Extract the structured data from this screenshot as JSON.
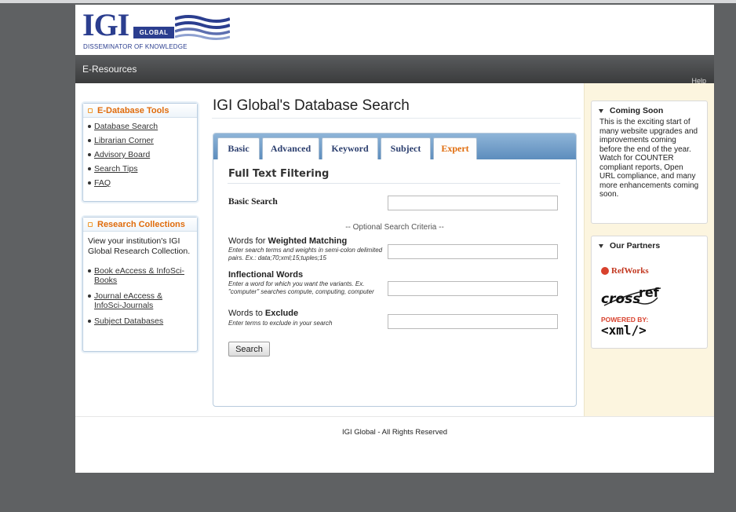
{
  "header": {
    "logo_main": "IGI",
    "logo_box": "GLOBAL",
    "logo_tagline": "DISSEMINATOR OF KNOWLEDGE",
    "nav_title": "E-Resources",
    "nav_right": "Help"
  },
  "sidebar": {
    "tools": {
      "title": "E-Database Tools",
      "items": [
        {
          "label": "Database Search"
        },
        {
          "label": "Librarian Corner"
        },
        {
          "label": "Advisory Board"
        },
        {
          "label": "Search Tips"
        },
        {
          "label": "FAQ"
        }
      ]
    },
    "collections": {
      "title": "Research Collections",
      "description": "View your institution's IGI Global Research Collection.",
      "items": [
        {
          "label": "Book eAccess & InfoSci-Books"
        },
        {
          "label": "Journal eAccess & InfoSci-Journals"
        },
        {
          "label": "Subject Databases"
        }
      ]
    }
  },
  "main": {
    "title": "IGI Global's Database Search",
    "tabs": [
      {
        "label": "Basic"
      },
      {
        "label": "Advanced"
      },
      {
        "label": "Keyword"
      },
      {
        "label": "Subject"
      },
      {
        "label": "Expert"
      }
    ],
    "active_tab": "Expert",
    "filter_heading": "Full Text Filtering",
    "basic_search_label": "Basic Search",
    "basic_search_value": "",
    "optional_caption": "-- Optional Search Criteria --",
    "weighted": {
      "label_prefix": "Words for ",
      "label_strong": "Weighted Matching",
      "hint": "Enter search terms and weights in semi-colon delimited pairs. Ex.: data;70;xml;15;tuples;15",
      "value": ""
    },
    "inflectional": {
      "label": "Inflectional Words",
      "hint": "Enter a word for which you want the variants. Ex. \"computer\" searches compute, computing, computer",
      "value": ""
    },
    "exclude": {
      "label_prefix": "Words to ",
      "label_strong": "Exclude",
      "hint": "Enter terms to exclude in your search",
      "value": ""
    },
    "search_button": "Search"
  },
  "right": {
    "coming_soon": {
      "title": "Coming Soon",
      "text": "This is the exciting start of many website upgrades and improvements coming before the end of the year. Watch for COUNTER compliant reports, Open URL compliance, and many more enhancements coming soon."
    },
    "partners": {
      "title": "Our Partners",
      "refworks": "RefWorks",
      "crossref_a": "cross",
      "crossref_b": "ref",
      "powered_by": "POWERED BY:",
      "xml": "<xml/>"
    }
  },
  "footer": {
    "text": "IGI Global - All Rights Reserved"
  },
  "colors": {
    "accent_orange": "#e06c0c",
    "brand_blue": "#2b3e8f",
    "tab_bar_blue": "#5d8dbd",
    "right_column_bg": "#fcf5df"
  }
}
